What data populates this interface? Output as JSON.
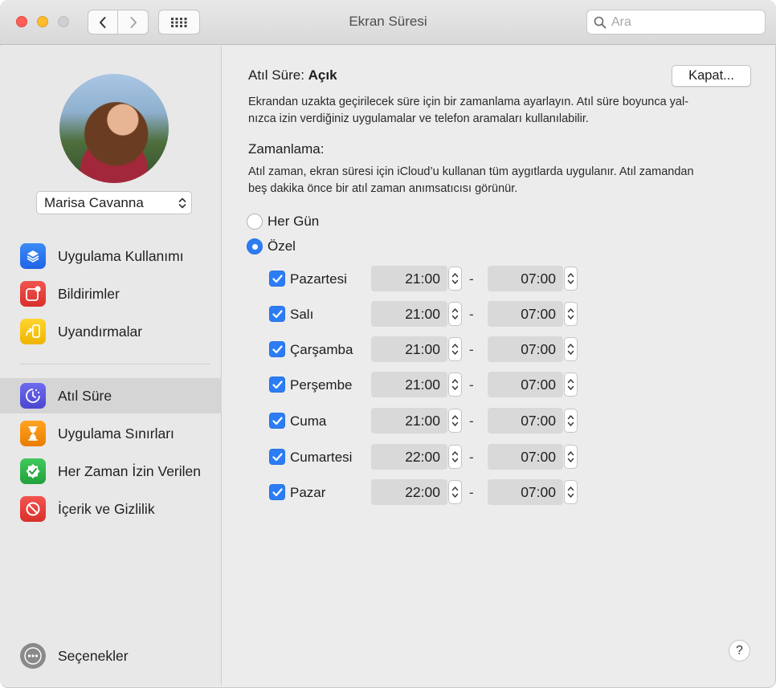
{
  "window": {
    "title": "Ekran Süresi"
  },
  "search": {
    "placeholder": "Ara"
  },
  "user": {
    "name": "Marisa Cavanna"
  },
  "sidebar": {
    "items": [
      {
        "label": "Uygulama Kullanımı",
        "icon": "layers-icon",
        "color": "#1f6ff0"
      },
      {
        "label": "Bildirimler",
        "icon": "notification-badge-icon",
        "color": "#e53935"
      },
      {
        "label": "Uyandırmalar",
        "icon": "pickup-phone-icon",
        "color": "#f5c400"
      },
      {
        "label": "Atıl Süre",
        "icon": "downtime-icon",
        "color": "#5856d6",
        "selected": true
      },
      {
        "label": "Uygulama Sınırları",
        "icon": "hourglass-icon",
        "color": "#f08a00"
      },
      {
        "label": "Her Zaman İzin Verilen",
        "icon": "checkmark-seal-icon",
        "color": "#2db24a"
      },
      {
        "label": "İçerik ve Gizlilik",
        "icon": "restriction-icon",
        "color": "#e53935"
      }
    ],
    "options_label": "Seçenekler"
  },
  "downtime": {
    "label": "Atıl Süre:",
    "status": "Açık",
    "toggle_button": "Kapat...",
    "description_line1": "Ekrandan uzakta geçirilecek süre için bir zamanlama ayarlayın. Atıl süre boyunca yal-",
    "description_line2": "nızca izin verdiğiniz uygulamalar ve telefon aramaları kullanılabilir."
  },
  "schedule": {
    "title": "Zamanlama:",
    "description_line1": "Atıl zaman, ekran süresi için iCloud’u kullanan tüm aygıtlarda uygulanır. Atıl zamandan",
    "description_line2": "beş dakika önce bir atıl zaman anımsatıcısı görünür.",
    "options": [
      {
        "label": "Her Gün",
        "selected": false
      },
      {
        "label": "Özel",
        "selected": true
      }
    ],
    "separator": "-",
    "days": [
      {
        "label": "Pazartesi",
        "checked": true,
        "start": "21:00",
        "end": "07:00"
      },
      {
        "label": "Salı",
        "checked": true,
        "start": "21:00",
        "end": "07:00"
      },
      {
        "label": "Çarşamba",
        "checked": true,
        "start": "21:00",
        "end": "07:00"
      },
      {
        "label": "Perşembe",
        "checked": true,
        "start": "21:00",
        "end": "07:00"
      },
      {
        "label": "Cuma",
        "checked": true,
        "start": "21:00",
        "end": "07:00"
      },
      {
        "label": "Cumartesi",
        "checked": true,
        "start": "22:00",
        "end": "07:00"
      },
      {
        "label": "Pazar",
        "checked": true,
        "start": "22:00",
        "end": "07:00"
      }
    ]
  },
  "help": {
    "label": "?"
  }
}
